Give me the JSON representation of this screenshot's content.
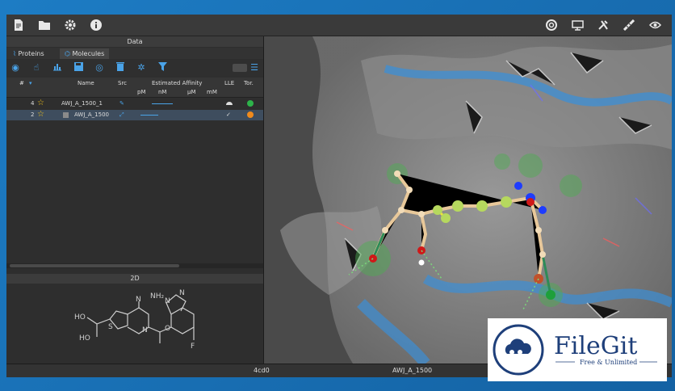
{
  "panel": {
    "title": "Data",
    "tabs": [
      {
        "label": "Proteins"
      },
      {
        "label": "Molecules"
      }
    ],
    "twod_title": "2D"
  },
  "table": {
    "headers": {
      "num": "#",
      "name": "Name",
      "src": "Src",
      "affinity": "Estimated Affinity",
      "lle": "LLE",
      "tor": "Tor."
    },
    "units": [
      "pM",
      "nM",
      "µM",
      "mM"
    ],
    "rows": [
      {
        "num": "4",
        "name": "AWJ_A_1500_1",
        "tor_color": "#2db34a"
      },
      {
        "num": "2",
        "name": "AWJ_A_1500",
        "tor_color": "#f08a1c"
      }
    ]
  },
  "molecule2d": {
    "atoms": {
      "oh1": "HO",
      "oh2": "HO",
      "nh2": "NH₂",
      "n1": "N",
      "n2": "N",
      "n3": "N",
      "n4": "N",
      "s": "S",
      "o": "O",
      "f": "F"
    }
  },
  "status": {
    "protein": "4cd0",
    "ligand": "AWJ_A_1500"
  },
  "logo": {
    "name": "FileGit",
    "tagline": "Free & Unlimited"
  },
  "colors": {
    "accent": "#4aa3e8",
    "frame": "#1a6fb5",
    "selected_row": "#3e4d5e"
  }
}
